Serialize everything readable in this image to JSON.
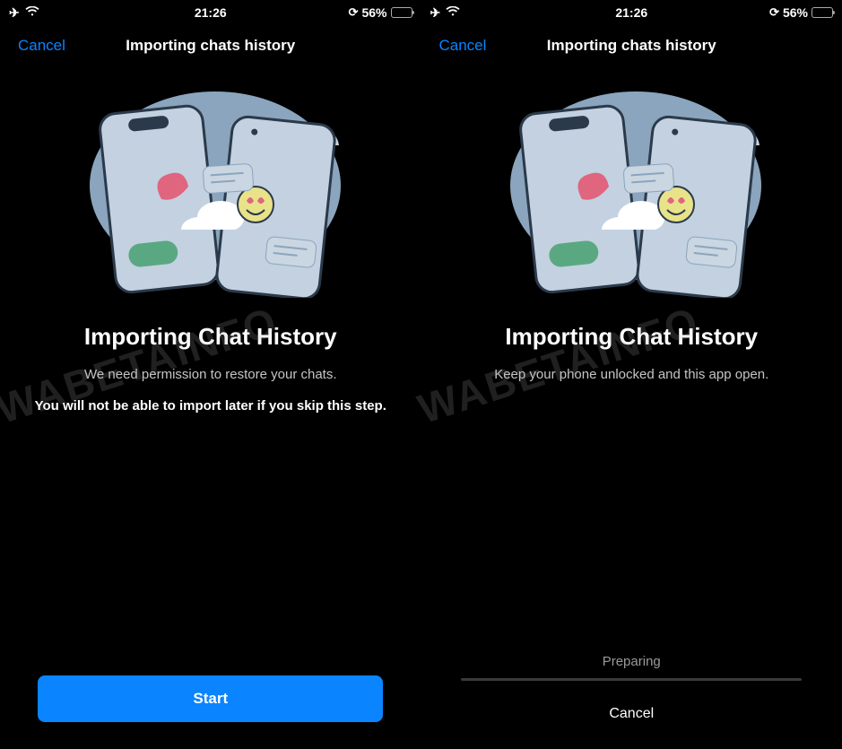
{
  "left": {
    "status": {
      "time": "21:26",
      "battery_text": "56%",
      "battery_fill_pct": 56
    },
    "nav": {
      "cancel": "Cancel",
      "title": "Importing chats history"
    },
    "heading": "Importing Chat History",
    "subtitle": "We need permission to restore your chats.",
    "warning": "You will not be able to import later if you skip this step.",
    "start": "Start"
  },
  "right": {
    "status": {
      "time": "21:26",
      "battery_text": "56%",
      "battery_fill_pct": 56
    },
    "nav": {
      "cancel": "Cancel",
      "title": "Importing chats history"
    },
    "heading": "Importing Chat History",
    "subtitle": "Keep your phone unlocked and this app open.",
    "preparing": "Preparing",
    "cancel_btn": "Cancel"
  },
  "watermark": "WABETAINFO",
  "colors": {
    "accent": "#0a84ff",
    "battery": "#ffd60a"
  }
}
